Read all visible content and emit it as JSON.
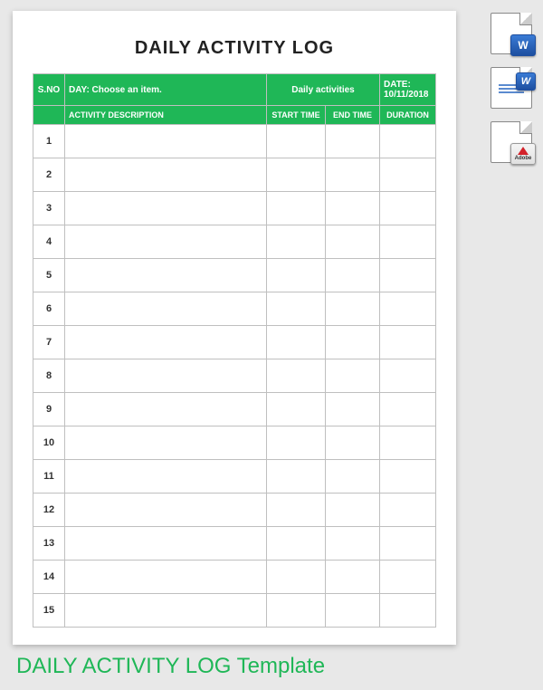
{
  "doc": {
    "title": "DAILY ACTIVITY LOG"
  },
  "header": {
    "snoLabel": "S.NO",
    "dayLabel": "DAY:  Choose an item.",
    "centerLabel": "Daily activities",
    "dateLabel": "DATE: 10/11/2018"
  },
  "columns": {
    "snBlank": "",
    "desc": "ACTIVITY DESCRIPTION",
    "start": "START TIME",
    "end": "END TIME",
    "dur": "DURATION"
  },
  "rows": [
    {
      "sn": "1",
      "desc": "",
      "start": "",
      "end": "",
      "dur": ""
    },
    {
      "sn": "2",
      "desc": "",
      "start": "",
      "end": "",
      "dur": ""
    },
    {
      "sn": "3",
      "desc": "",
      "start": "",
      "end": "",
      "dur": ""
    },
    {
      "sn": "4",
      "desc": "",
      "start": "",
      "end": "",
      "dur": ""
    },
    {
      "sn": "5",
      "desc": "",
      "start": "",
      "end": "",
      "dur": ""
    },
    {
      "sn": "6",
      "desc": "",
      "start": "",
      "end": "",
      "dur": ""
    },
    {
      "sn": "7",
      "desc": "",
      "start": "",
      "end": "",
      "dur": ""
    },
    {
      "sn": "8",
      "desc": "",
      "start": "",
      "end": "",
      "dur": ""
    },
    {
      "sn": "9",
      "desc": "",
      "start": "",
      "end": "",
      "dur": ""
    },
    {
      "sn": "10",
      "desc": "",
      "start": "",
      "end": "",
      "dur": ""
    },
    {
      "sn": "11",
      "desc": "",
      "start": "",
      "end": "",
      "dur": ""
    },
    {
      "sn": "12",
      "desc": "",
      "start": "",
      "end": "",
      "dur": ""
    },
    {
      "sn": "13",
      "desc": "",
      "start": "",
      "end": "",
      "dur": ""
    },
    {
      "sn": "14",
      "desc": "",
      "start": "",
      "end": "",
      "dur": ""
    },
    {
      "sn": "15",
      "desc": "",
      "start": "",
      "end": "",
      "dur": ""
    }
  ],
  "footer": {
    "title": "DAILY ACTIVITY LOG Template"
  },
  "icons": {
    "word": "W",
    "wordDoc": "W",
    "pdf": "Adobe"
  }
}
